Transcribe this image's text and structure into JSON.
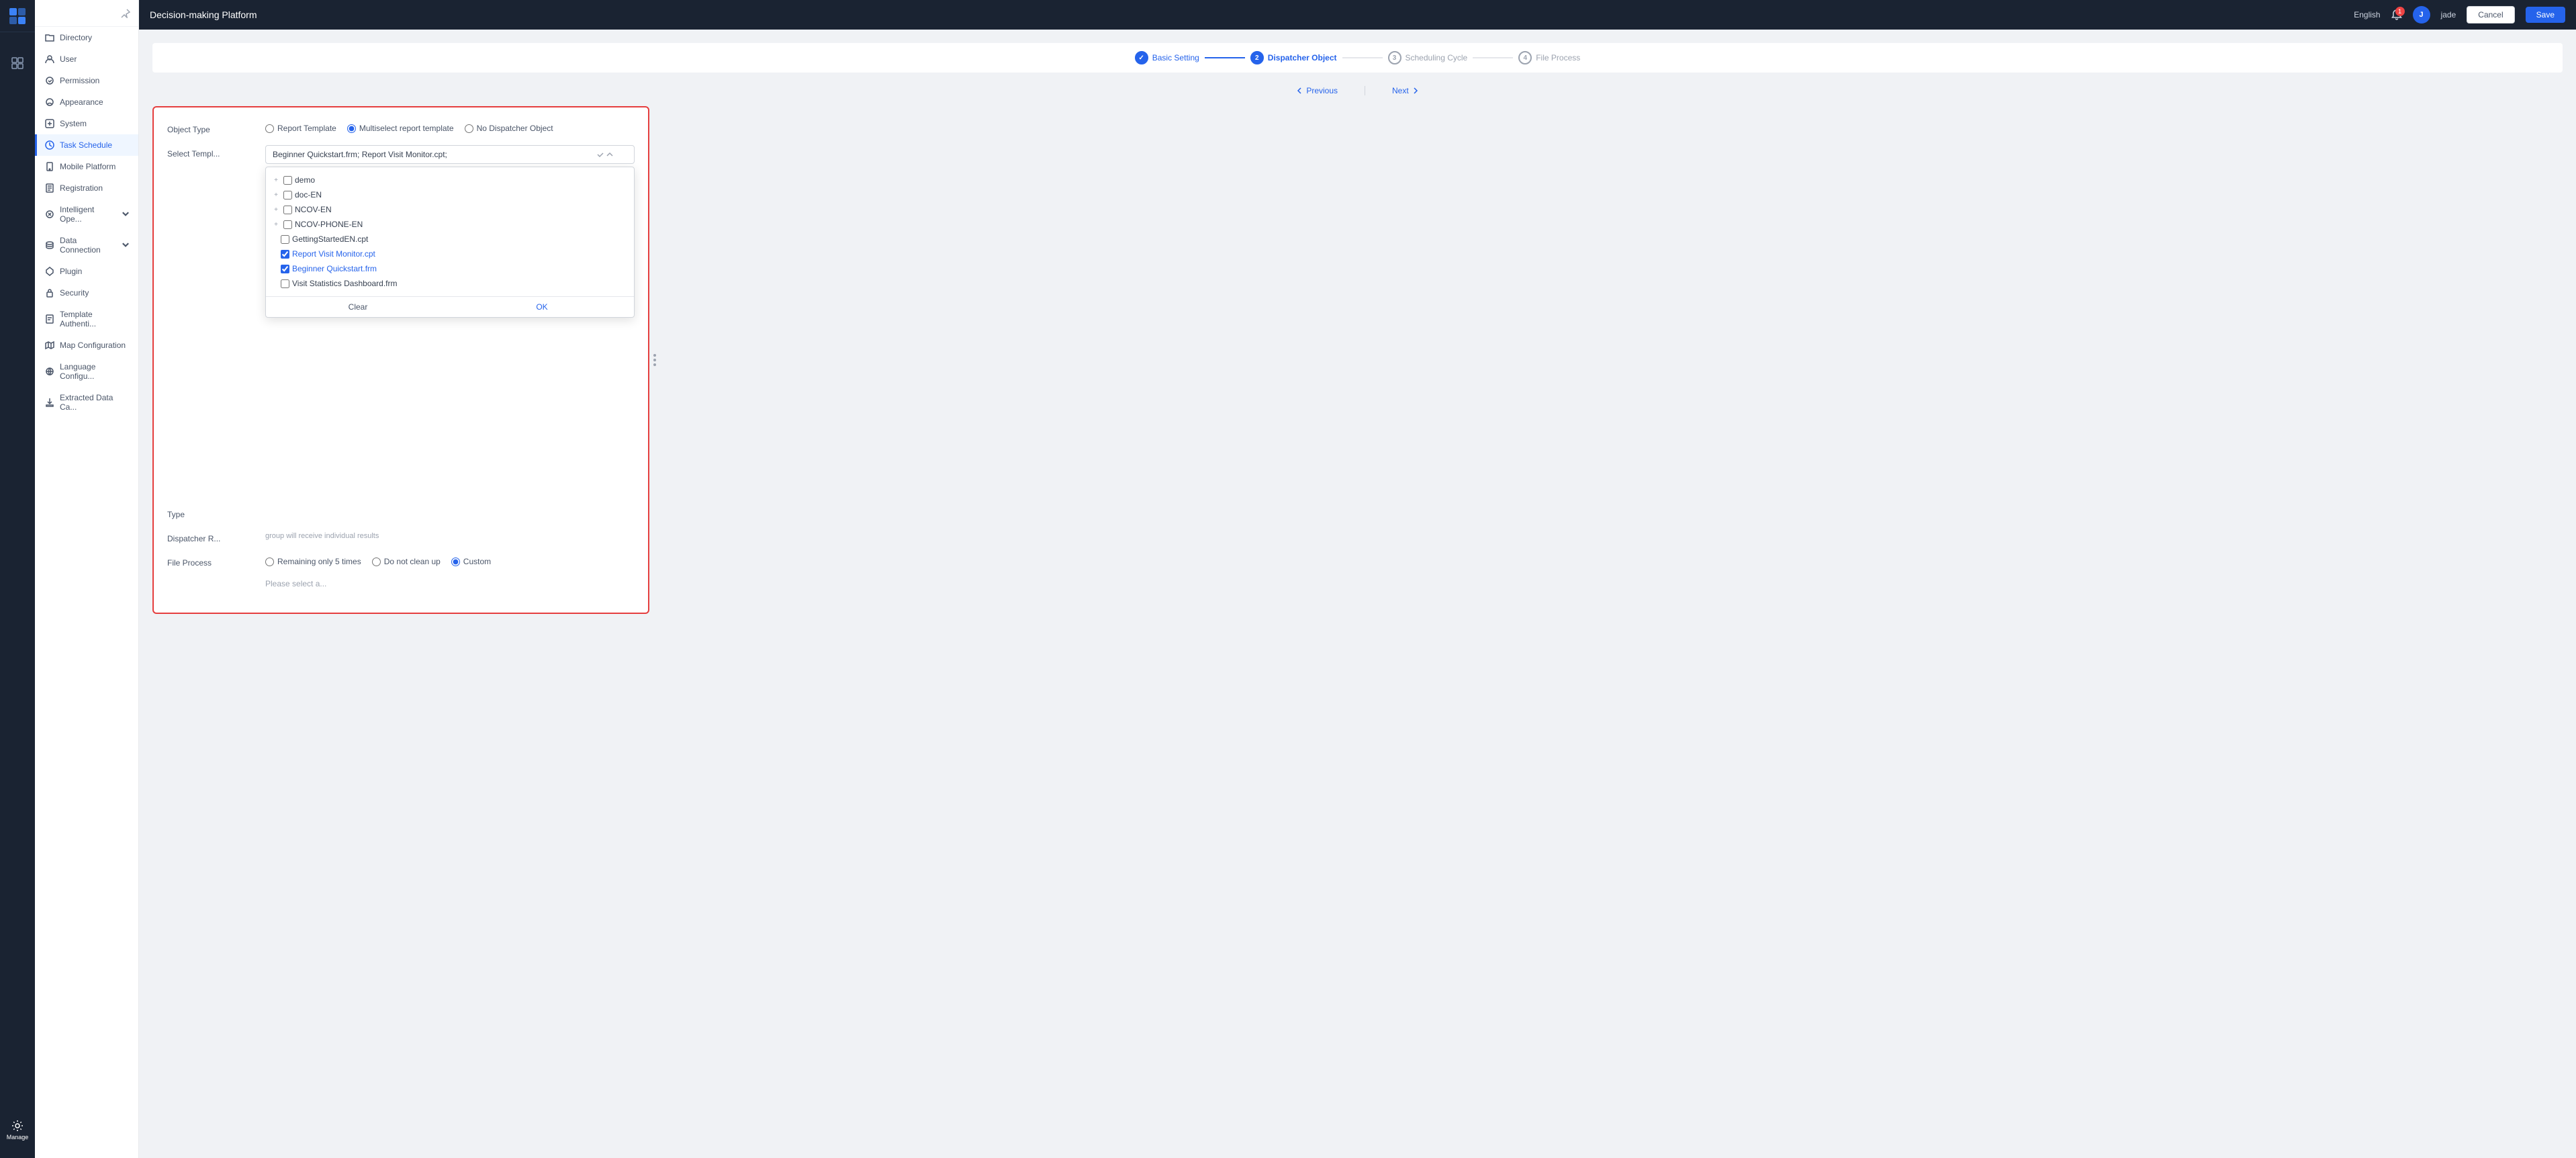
{
  "app": {
    "title": "Decision-making Platform",
    "language": "English",
    "user": "jade"
  },
  "topbar": {
    "cancel_label": "Cancel",
    "save_label": "Save"
  },
  "icon_bar": {
    "items": [
      {
        "id": "grid",
        "label": ""
      },
      {
        "id": "manage",
        "label": "Manage"
      }
    ]
  },
  "sidebar": {
    "items": [
      {
        "id": "directory",
        "label": "Directory",
        "icon": "folder"
      },
      {
        "id": "user",
        "label": "User",
        "icon": "user"
      },
      {
        "id": "permission",
        "label": "Permission",
        "icon": "shield"
      },
      {
        "id": "appearance",
        "label": "Appearance",
        "icon": "brush"
      },
      {
        "id": "system",
        "label": "System",
        "icon": "settings"
      },
      {
        "id": "task-schedule",
        "label": "Task Schedule",
        "icon": "clock",
        "active": true
      },
      {
        "id": "mobile-platform",
        "label": "Mobile Platform",
        "icon": "mobile"
      },
      {
        "id": "registration",
        "label": "Registration",
        "icon": "file-text"
      },
      {
        "id": "intelligent-ope",
        "label": "Intelligent Ope...",
        "icon": "cpu"
      },
      {
        "id": "data-connection",
        "label": "Data Connection",
        "icon": "database",
        "has-arrow": true
      },
      {
        "id": "plugin",
        "label": "Plugin",
        "icon": "plug"
      },
      {
        "id": "security",
        "label": "Security",
        "icon": "lock"
      },
      {
        "id": "template-authen",
        "label": "Template Authenti...",
        "icon": "file-check"
      },
      {
        "id": "map-config",
        "label": "Map Configuration",
        "icon": "map"
      },
      {
        "id": "language-config",
        "label": "Language Configu...",
        "icon": "globe"
      },
      {
        "id": "extracted-data",
        "label": "Extracted Data Ca...",
        "icon": "download"
      }
    ]
  },
  "steps": [
    {
      "num": "✓",
      "label": "Basic Setting",
      "state": "done"
    },
    {
      "num": "2",
      "label": "Dispatcher Object",
      "state": "active"
    },
    {
      "num": "3",
      "label": "Scheduling Cycle",
      "state": "inactive"
    },
    {
      "num": "4",
      "label": "File Process",
      "state": "inactive"
    }
  ],
  "nav": {
    "previous": "Previous",
    "next": "Next"
  },
  "form": {
    "object_type_label": "Object Type",
    "radio_options": [
      {
        "id": "report-template",
        "label": "Report Template"
      },
      {
        "id": "multiselect",
        "label": "Multiselect report template",
        "checked": true
      },
      {
        "id": "no-dispatcher",
        "label": "No Dispatcher Object"
      }
    ],
    "select_template_label": "Select Templ...",
    "select_template_value": "Beginner Quickstart.frm; Report Visit Monitor.cpt;",
    "type_label": "Type",
    "dispatcher_r_label": "Dispatcher R...",
    "dispatcher_hint": "group will receive individual results",
    "file_process_label": "File Process",
    "file_process_options": [
      {
        "id": "remaining",
        "label": "Remaining only 5 times"
      },
      {
        "id": "do-not-clean",
        "label": "Do not clean up"
      },
      {
        "id": "custom",
        "label": "Custom",
        "checked": true
      }
    ],
    "dispatcher_placeholder": "Please select a...",
    "dropdown": {
      "items": [
        {
          "id": "demo",
          "label": "demo",
          "level": 0,
          "expandable": true,
          "checked": false
        },
        {
          "id": "doc-en",
          "label": "doc-EN",
          "level": 0,
          "expandable": true,
          "checked": false
        },
        {
          "id": "ncov-en",
          "label": "NCOV-EN",
          "level": 0,
          "expandable": true,
          "checked": false
        },
        {
          "id": "ncov-phone-en",
          "label": "NCOV-PHONE-EN",
          "level": 0,
          "expandable": true,
          "checked": false
        },
        {
          "id": "getting-started",
          "label": "GettingStartedEN.cpt",
          "level": 1,
          "expandable": false,
          "checked": false
        },
        {
          "id": "report-visit",
          "label": "Report Visit Monitor.cpt",
          "level": 1,
          "expandable": false,
          "checked": true,
          "blue": true
        },
        {
          "id": "beginner",
          "label": "Beginner Quickstart.frm",
          "level": 1,
          "expandable": false,
          "checked": true,
          "blue": true
        },
        {
          "id": "visit-stats",
          "label": "Visit Statistics Dashboard.frm",
          "level": 1,
          "expandable": false,
          "checked": false
        }
      ],
      "clear_label": "Clear",
      "ok_label": "OK"
    }
  }
}
